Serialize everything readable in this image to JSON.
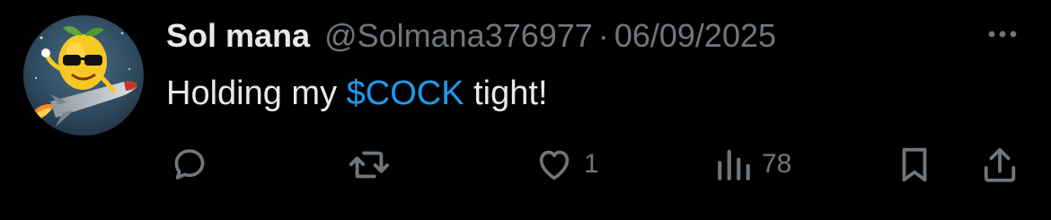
{
  "tweet": {
    "author": {
      "display_name": "Sol mana",
      "handle": "@Solmana376977",
      "avatar_icon": "lemon-rocket-avatar"
    },
    "separator": "·",
    "date": "06/09/2025",
    "text_before": "Holding my ",
    "cashtag": "$COCK",
    "text_after": " tight!",
    "actions": {
      "reply": {
        "icon": "reply-icon"
      },
      "retweet": {
        "icon": "retweet-icon"
      },
      "like": {
        "icon": "heart-icon",
        "count": "1"
      },
      "views": {
        "icon": "views-icon",
        "count": "78"
      },
      "bookmark": {
        "icon": "bookmark-icon"
      },
      "share": {
        "icon": "share-icon"
      }
    },
    "more_icon": "more-options-icon"
  },
  "colors": {
    "background": "#000000",
    "primary_text": "#e7e9ea",
    "secondary_text": "#71767b",
    "cashtag": "#1d9bf0"
  }
}
